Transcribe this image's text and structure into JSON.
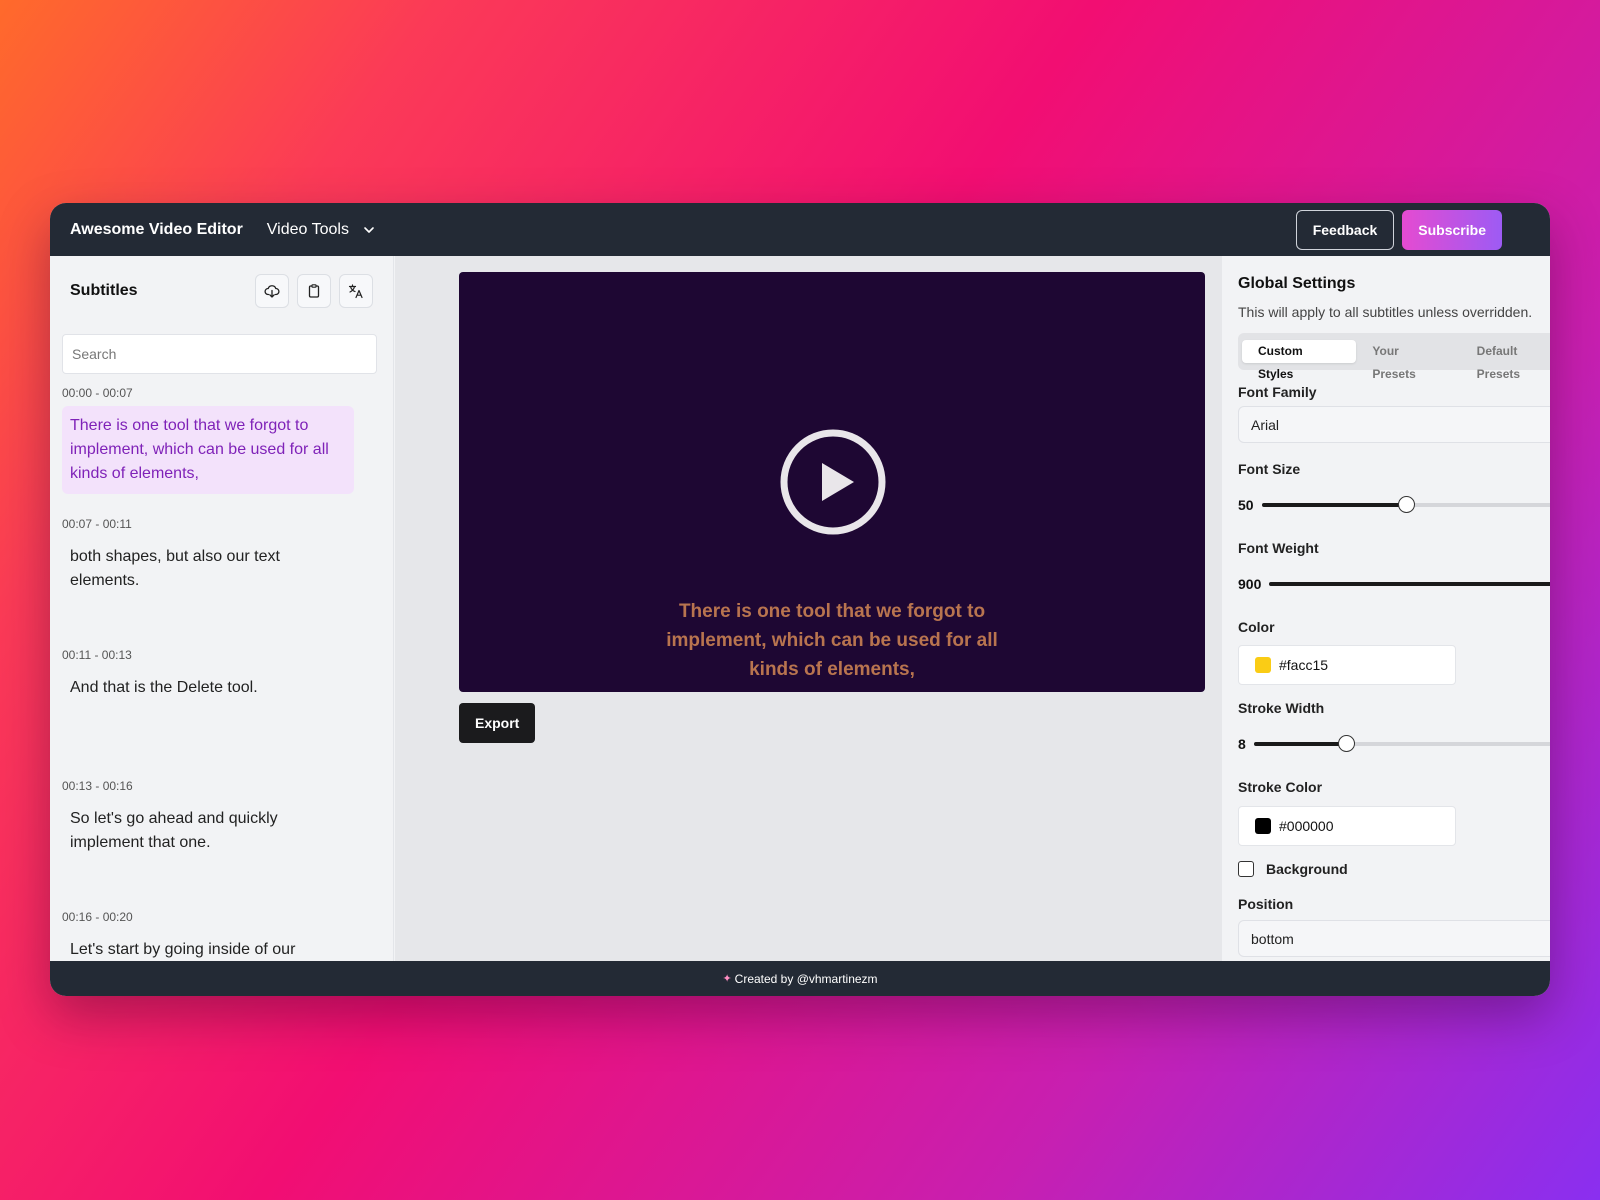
{
  "header": {
    "app_title": "Awesome Video Editor",
    "nav_menu_label": "Video Tools",
    "feedback_label": "Feedback",
    "subscribe_label": "Subscribe"
  },
  "subtitles": {
    "title": "Subtitles",
    "toolbar_icons": [
      "cloud-download-icon",
      "clipboard-icon",
      "translate-icon"
    ],
    "search_placeholder": "Search",
    "items": [
      {
        "time": "00:00 - 00:07",
        "text": "There is one tool that we forgot to implement, which can be used for all kinds of elements,",
        "active": true
      },
      {
        "time": "00:07 - 00:11",
        "text": "both shapes, but also our text elements.",
        "active": false
      },
      {
        "time": "00:11 - 00:13",
        "text": "And that is the Delete tool.",
        "active": false
      },
      {
        "time": "00:13 - 00:16",
        "text": "So let's go ahead and quickly implement that one.",
        "active": false
      },
      {
        "time": "00:16 - 00:20",
        "text": "Let's start by going inside of our",
        "active": false
      }
    ]
  },
  "player": {
    "caption_lines": [
      "There is one tool that we forgot to",
      "implement, which can be used for all",
      "kinds of elements,"
    ],
    "play_icon": "play-circle-icon",
    "export_label": "Export"
  },
  "settings": {
    "title": "Global Settings",
    "description": "This will apply to all subtitles unless overridden.",
    "tabs": [
      "Custom Styles",
      "Your Presets",
      "Default Presets"
    ],
    "active_tab": "Custom Styles",
    "font_family_label": "Font Family",
    "font_family_value": "Arial",
    "font_size_label": "Font Size",
    "font_size_value": "50",
    "font_size_fraction": 0.45,
    "font_weight_label": "Font Weight",
    "font_weight_value": "900",
    "font_weight_fraction": 1.0,
    "color_label": "Color",
    "color_value": "#facc15",
    "stroke_width_label": "Stroke Width",
    "stroke_width_value": "8",
    "stroke_width_fraction": 0.28,
    "stroke_color_label": "Stroke Color",
    "stroke_color_value": "#000000",
    "background_label": "Background",
    "background_checked": false,
    "position_label": "Position",
    "position_value": "bottom"
  },
  "footer": {
    "text": "Created by @vhmartinezm"
  }
}
